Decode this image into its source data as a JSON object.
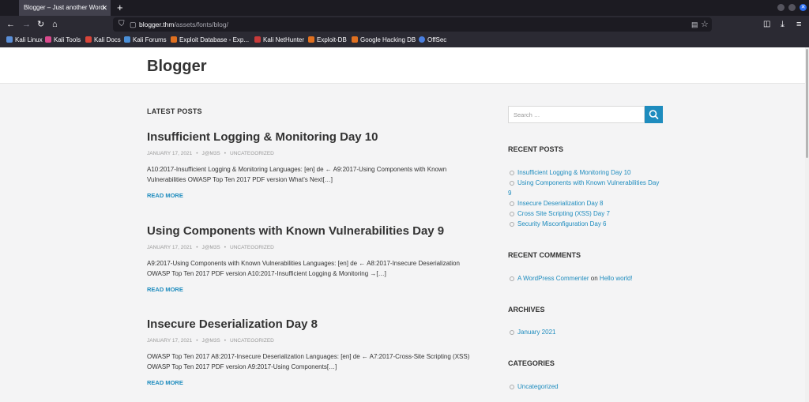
{
  "browser": {
    "tab_title": "Blogger – Just another Word",
    "url_host": "blogger.thm",
    "url_path": "/assets/fonts/blog/",
    "bookmarks": [
      {
        "label": "Kali Linux",
        "color": "#5a8fd8"
      },
      {
        "label": "Kali Tools",
        "color": "#d94a8c"
      },
      {
        "label": "Kali Docs",
        "color": "#d8453a"
      },
      {
        "label": "Kali Forums",
        "color": "#4a8fd8"
      },
      {
        "label": "Exploit Database - Exp...",
        "color": "#e07020"
      },
      {
        "label": "Kali NetHunter",
        "color": "#c83a3a"
      },
      {
        "label": "Exploit-DB",
        "color": "#e07020"
      },
      {
        "label": "Google Hacking DB",
        "color": "#e07020"
      },
      {
        "label": "OffSec",
        "color": "#4a7fe0"
      }
    ]
  },
  "site": {
    "title": "Blogger"
  },
  "main": {
    "heading": "LATEST POSTS",
    "posts": [
      {
        "title": "Insufficient Logging & Monitoring Day 10",
        "date": "JANUARY 17, 2021",
        "author": "J@M3S",
        "category": "UNCATEGORIZED",
        "excerpt": "A10:2017-Insufficient Logging & Monitoring Languages: [en] de ← A9:2017-Using Components with Known Vulnerabilities OWASP Top Ten 2017 PDF version What’s Next[…]",
        "read_more": "READ MORE"
      },
      {
        "title": "Using Components with Known Vulnerabilities Day 9",
        "date": "JANUARY 17, 2021",
        "author": "J@M3S",
        "category": "UNCATEGORIZED",
        "excerpt": "A9:2017-Using Components with Known Vulnerabilities Languages: [en] de ← A8:2017-Insecure Deserialization OWASP Top Ten 2017 PDF version A10:2017-Insufficient Logging & Monitoring →[…]",
        "read_more": "READ MORE"
      },
      {
        "title": "Insecure Deserialization Day 8",
        "date": "JANUARY 17, 2021",
        "author": "J@M3S",
        "category": "UNCATEGORIZED",
        "excerpt": "OWASP Top Ten 2017 A8:2017-Insecure Deserialization Languages: [en] de ← A7:2017-Cross-Site Scripting (XSS) OWASP Top Ten 2017 PDF version A9:2017-Using Components[…]",
        "read_more": "READ MORE"
      }
    ]
  },
  "sidebar": {
    "search_placeholder": "Search …",
    "recent_posts_title": "RECENT POSTS",
    "recent_posts": [
      "Insufficient Logging & Monitoring Day 10",
      "Using Components with Known Vulnerabilities Day 9",
      "Insecure Deserialization Day 8",
      "Cross Site Scripting (XSS) Day 7",
      "Security Misconfiguration Day 6"
    ],
    "recent_comments_title": "RECENT COMMENTS",
    "comment_author": "A WordPress Commenter",
    "comment_on": "on",
    "comment_post": "Hello world!",
    "archives_title": "ARCHIVES",
    "archives": [
      "January 2021"
    ],
    "categories_title": "CATEGORIES",
    "categories": [
      "Uncategorized"
    ]
  },
  "colors": {
    "accent": "#1e8cbe",
    "text": "#333333",
    "browser_dark": "#2b2a33"
  }
}
